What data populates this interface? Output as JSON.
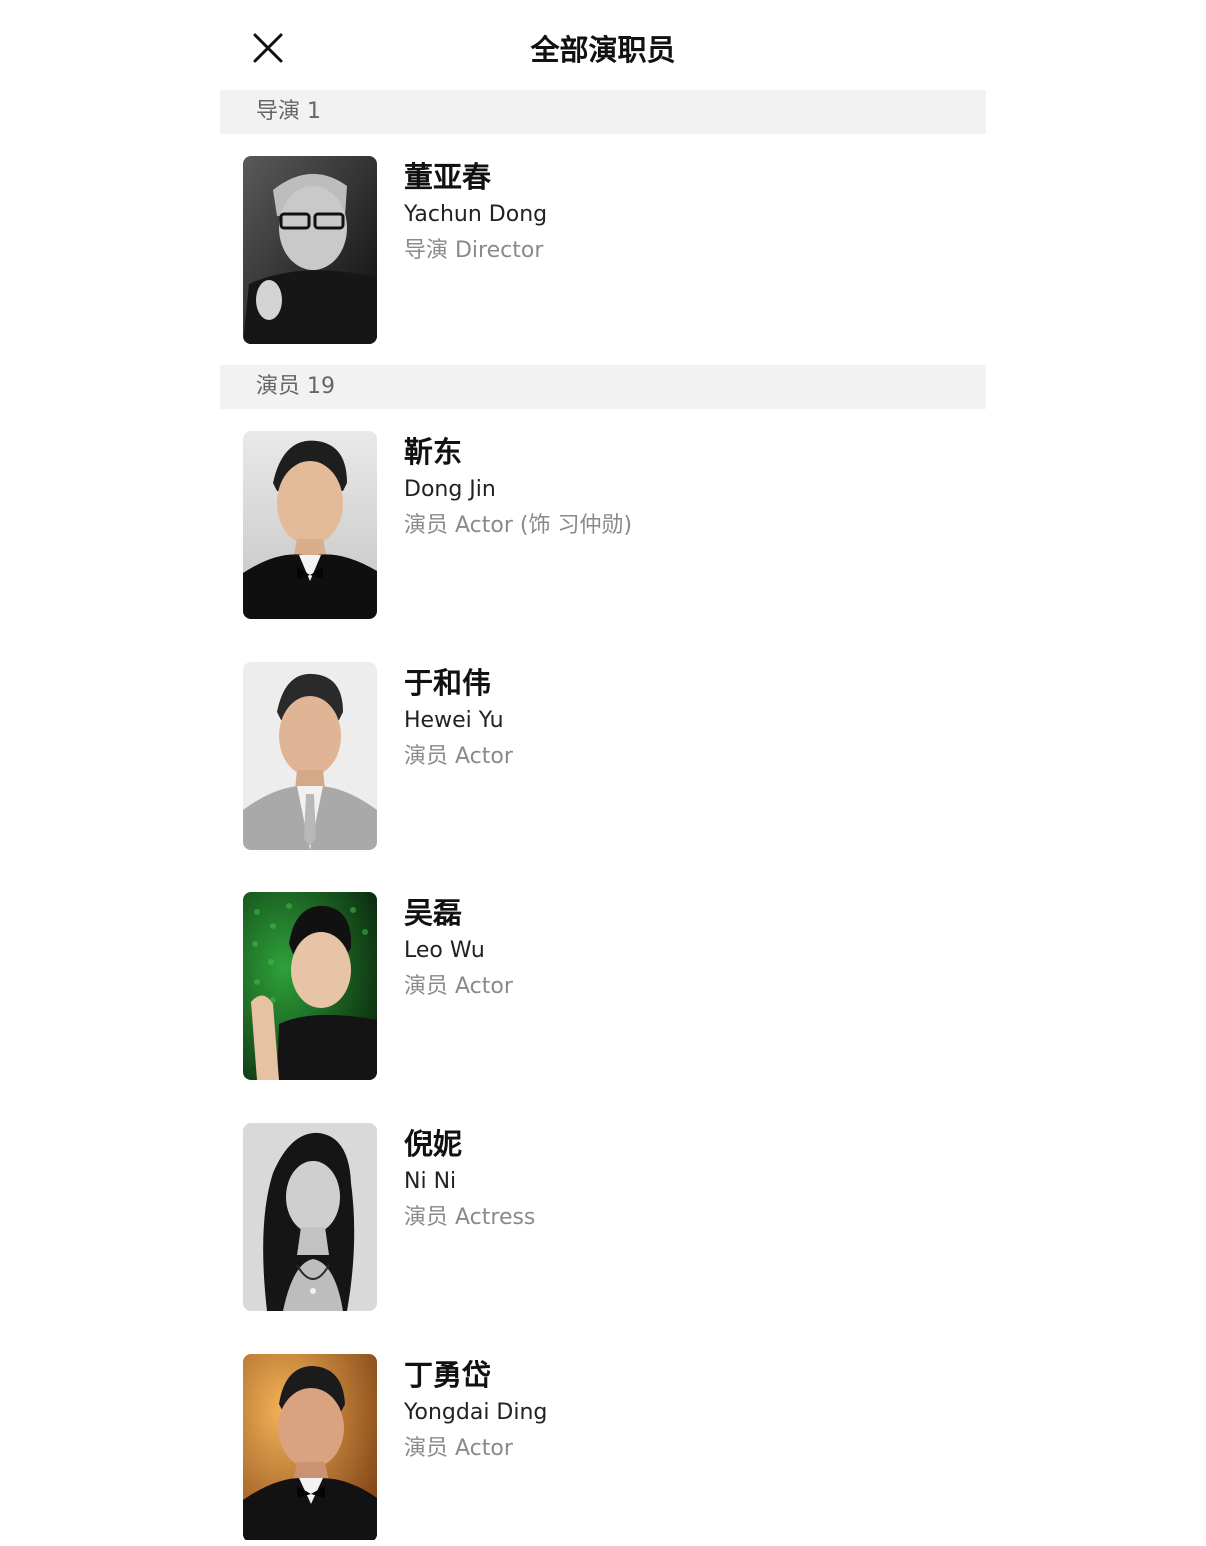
{
  "header": {
    "title": "全部演职员",
    "close_icon": "close-icon"
  },
  "sections": [
    {
      "label": "导演 1",
      "people": [
        {
          "name_zh": "董亚春",
          "name_en": "Yachun Dong",
          "role": "导演 Director"
        }
      ]
    },
    {
      "label": "演员 19",
      "people": [
        {
          "name_zh": "靳东",
          "name_en": "Dong Jin",
          "role": "演员 Actor (饰 习仲勋)"
        },
        {
          "name_zh": "于和伟",
          "name_en": "Hewei Yu",
          "role": "演员 Actor"
        },
        {
          "name_zh": "吴磊",
          "name_en": "Leo Wu",
          "role": "演员 Actor"
        },
        {
          "name_zh": "倪妮",
          "name_en": "Ni Ni",
          "role": "演员 Actress"
        },
        {
          "name_zh": "丁勇岱",
          "name_en": "Yongdai Ding",
          "role": "演员 Actor"
        }
      ]
    }
  ],
  "colors": {
    "section_background": "#f2f2f2",
    "secondary_text": "#8a8a8a",
    "primary_text": "#111111"
  }
}
